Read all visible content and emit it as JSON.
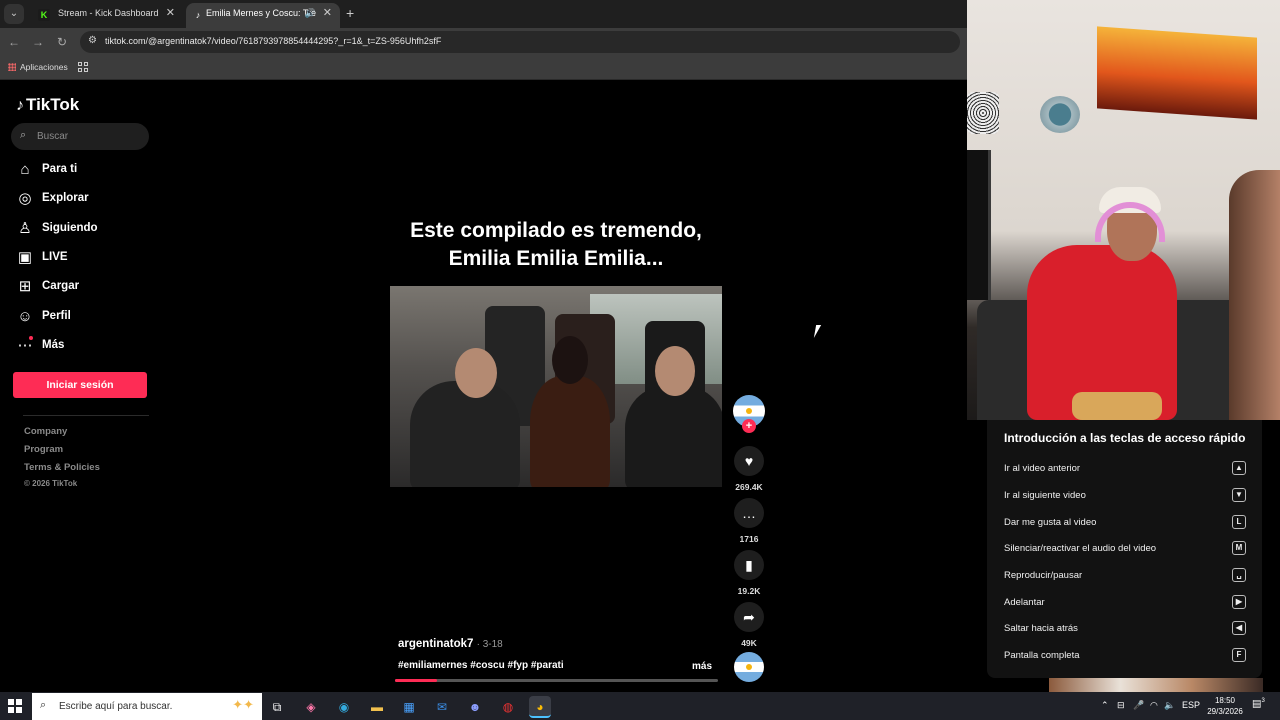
{
  "browser": {
    "tabs": [
      {
        "title": "Stream - Kick Dashboard",
        "favicon": "K"
      },
      {
        "title": "Emilia Mernes y Coscu: Tre",
        "favicon": "tiktok-icon"
      }
    ],
    "url": "tiktok.com/@argentinatok7/video/7618793978854444295?_r=1&_t=ZS-956Uhfh2sfF",
    "bookmarks": {
      "apps_label": "Aplicaciones"
    }
  },
  "tiktok": {
    "logo_text": "TikTok",
    "search_placeholder": "Buscar",
    "nav": [
      {
        "label": "Para ti",
        "icon": "home-icon"
      },
      {
        "label": "Explorar",
        "icon": "compass-icon"
      },
      {
        "label": "Siguiendo",
        "icon": "following-icon"
      },
      {
        "label": "LIVE",
        "icon": "live-icon"
      },
      {
        "label": "Cargar",
        "icon": "upload-icon"
      },
      {
        "label": "Perfil",
        "icon": "profile-icon"
      },
      {
        "label": "Más",
        "icon": "more-icon"
      }
    ],
    "login_label": "Iniciar sesión",
    "footer": {
      "links": [
        "Company",
        "Program",
        "Terms & Policies"
      ],
      "copyright": "© 2026 TikTok"
    },
    "video": {
      "caption_line1": "Este compilado es tremendo,",
      "caption_line2": "Emilia Emilia Emilia...",
      "author": "argentinatok7",
      "date": "· 3-18",
      "hashtags": "#emiliamernes #coscu #fyp #parati",
      "more_label": "más",
      "progress_percent": 13,
      "likes": "269.4K",
      "comments": "1716",
      "saves": "19.2K",
      "shares": "49K"
    },
    "accent_color": "#fe2c55"
  },
  "shortcuts": {
    "title": "Introducción a las teclas de acceso rápido",
    "items": [
      {
        "label": "Ir al video anterior",
        "key": "▲"
      },
      {
        "label": "Ir al siguiente video",
        "key": "▼"
      },
      {
        "label": "Dar me gusta al video",
        "key": "L"
      },
      {
        "label": "Silenciar/reactivar el audio del video",
        "key": "M"
      },
      {
        "label": "Reproducir/pausar",
        "key": "␣"
      },
      {
        "label": "Adelantar",
        "key": "▶"
      },
      {
        "label": "Saltar hacia atrás",
        "key": "◀"
      },
      {
        "label": "Pantalla completa",
        "key": "F"
      }
    ]
  },
  "taskbar": {
    "search_placeholder": "Escribe aquí para buscar.",
    "language": "ESP",
    "time": "18:50",
    "date": "29/3/2026",
    "notification_count": "3"
  }
}
